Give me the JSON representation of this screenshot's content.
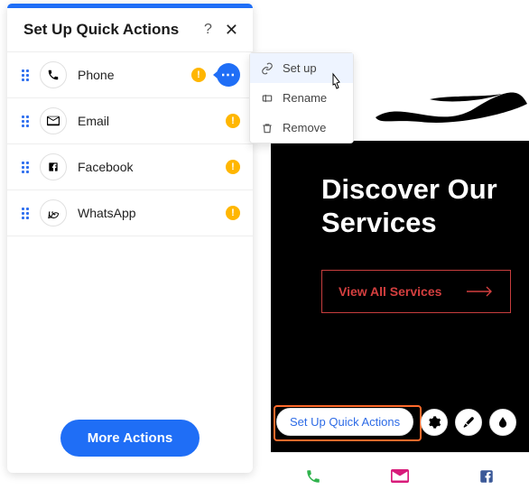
{
  "panel": {
    "title": "Set Up Quick Actions",
    "items": [
      {
        "label": "Phone",
        "icon": "phone"
      },
      {
        "label": "Email",
        "icon": "email"
      },
      {
        "label": "Facebook",
        "icon": "facebook"
      },
      {
        "label": "WhatsApp",
        "icon": "whatsapp"
      }
    ],
    "more_btn": "More Actions"
  },
  "ctx": {
    "setup": "Set up",
    "rename": "Rename",
    "remove": "Remove"
  },
  "preview": {
    "heading_l1": "Discover Our",
    "heading_l2": "Services",
    "cta": "View All Services",
    "toolstrip_pill": "Set Up Quick Actions"
  }
}
